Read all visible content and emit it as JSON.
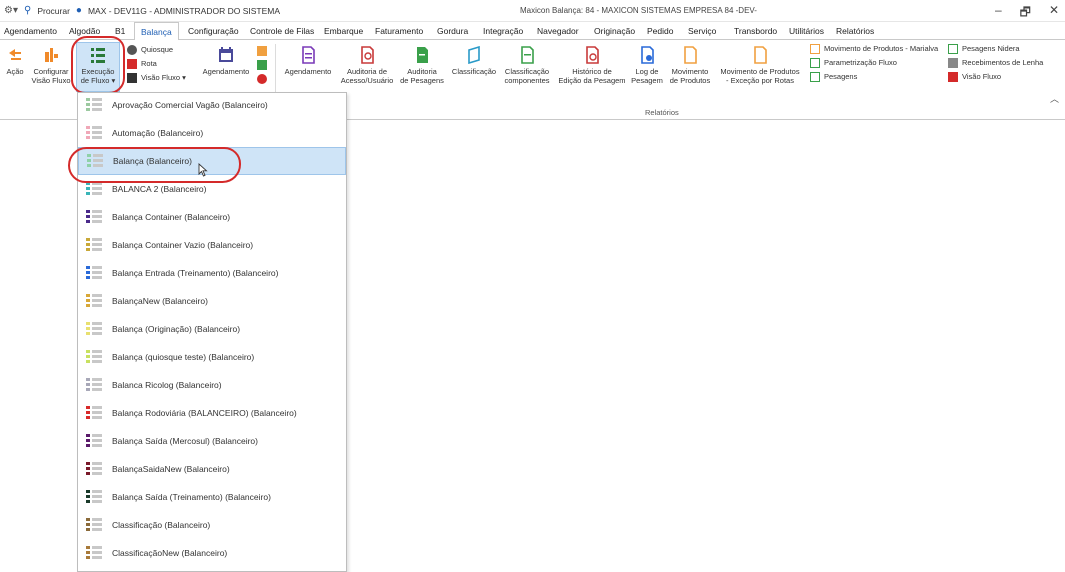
{
  "titlebar": {
    "search_label": "Procurar",
    "user_label": "MAX - DEV11G - ADMINISTRADOR DO SISTEMA",
    "window_title": "Maxicon Balança: 84 - MAXICON SISTEMAS EMPRESA 84 -DEV-",
    "minimize": "–",
    "restore": "🗗",
    "close": "✕"
  },
  "tabs": [
    "Agendamento",
    "Algodão",
    "B1",
    "Balança",
    "Configuração",
    "Controle de Filas",
    "Embarque",
    "Faturamento",
    "Gordura",
    "Integração",
    "Navegador",
    "Originação",
    "Pedido",
    "Serviço",
    "Transbordo",
    "Utilitários",
    "Relatórios"
  ],
  "active_tab": "Balança",
  "ribbon": {
    "acao": "Ação",
    "configurar_l1": "Configurar",
    "configurar_l2": "Visão Fluxo",
    "execucao_l1": "Execução",
    "execucao_l2": "de Fluxo ▾",
    "quiosque": "Quiosque",
    "rota": "Rota",
    "visao_fluxo_dd": "Visão Fluxo ▾",
    "agendamento1": "Agendamento",
    "agendamento2": "Agendamento",
    "auditoria_acesso_l1": "Auditoria de",
    "auditoria_acesso_l2": "Acesso/Usuário",
    "auditoria_pesagens_l1": "Auditoria",
    "auditoria_pesagens_l2": "de Pesagens",
    "classificacao": "Classificação",
    "classificacao_comp_l1": "Classificação",
    "classificacao_comp_l2": "componentes",
    "historico_l1": "Histórico de",
    "historico_l2": "Edição da Pesagem",
    "log_l1": "Log de",
    "log_l2": "Pesagem",
    "movimento_l1": "Movimento",
    "movimento_l2": "de Produtos",
    "mov_excecao_l1": "Movimento de Produtos",
    "mov_excecao_l2": "- Exceção por Rotas",
    "group_label": "Relatórios",
    "right_col1": [
      "Movimento de Produtos - Marialva",
      "Parametrização Fluxo",
      "Pesagens"
    ],
    "right_col2": [
      "Pesagens Nidera",
      "Recebimentos de Lenha",
      "Visão Fluxo"
    ]
  },
  "menu_items": [
    {
      "label": "Aprovação Comercial Vagão (Balanceiro)",
      "color": "#9cc9a0"
    },
    {
      "label": "Automação (Balanceiro)",
      "color": "#f0a8b8"
    },
    {
      "label": "Balança (Balanceiro)",
      "color": "#8fd1a8"
    },
    {
      "label": "BALANCA 2 (Balanceiro)",
      "color": "#3ab5b8"
    },
    {
      "label": "Balança Container (Balanceiro)",
      "color": "#4a2a8a"
    },
    {
      "label": "Balança Container Vazio (Balanceiro)",
      "color": "#c8a838"
    },
    {
      "label": "Balança Entrada (Treinamento) (Balanceiro)",
      "color": "#2a6ad8"
    },
    {
      "label": "BalançaNew (Balanceiro)",
      "color": "#d8a838"
    },
    {
      "label": "Balança (Originação) (Balanceiro)",
      "color": "#e8e070"
    },
    {
      "label": "Balança (quiosque teste) (Balanceiro)",
      "color": "#c8e060"
    },
    {
      "label": "Balanca Ricolog (Balanceiro)",
      "color": "#a8a8b8"
    },
    {
      "label": "Balança Rodoviária (BALANCEIRO) (Balanceiro)",
      "color": "#d82a2a"
    },
    {
      "label": "Balança Saída (Mercosul) (Balanceiro)",
      "color": "#5a1a6a"
    },
    {
      "label": "BalançaSaidaNew (Balanceiro)",
      "color": "#7a1a2a"
    },
    {
      "label": "Balança Saída (Treinamento) (Balanceiro)",
      "color": "#1a3a2a"
    },
    {
      "label": "Classificação (Balanceiro)",
      "color": "#8a6a3a"
    },
    {
      "label": "ClassificaçãoNew (Balanceiro)",
      "color": "#a87a3a"
    }
  ],
  "selected_item": "Balança (Balanceiro)"
}
